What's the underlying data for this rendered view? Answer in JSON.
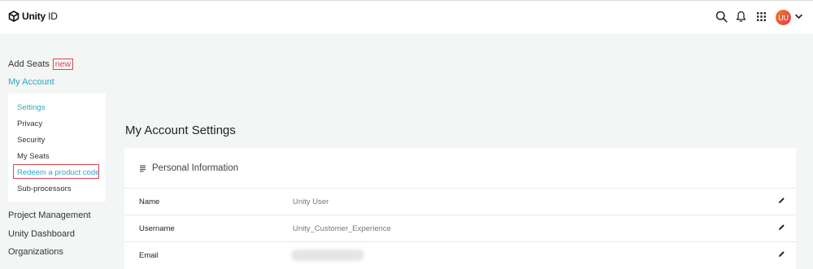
{
  "header": {
    "brand_bold": "Unity",
    "brand_light": " ID",
    "avatar_initials": "UU",
    "icons": [
      "search-icon",
      "bell-icon",
      "apps-grid-icon",
      "chevron-down-icon"
    ]
  },
  "sidebar": {
    "add_seats": "Add Seats",
    "new_badge": "new",
    "my_account": "My Account",
    "subitems": [
      {
        "label": "Settings"
      },
      {
        "label": "Privacy"
      },
      {
        "label": "Security"
      },
      {
        "label": "My Seats"
      },
      {
        "label": "Redeem a product code"
      },
      {
        "label": "Sub-processors"
      }
    ],
    "project_management": "Project Management",
    "unity_dashboard": "Unity Dashboard",
    "organizations": "Organizations"
  },
  "main": {
    "title": "My Account Settings",
    "section_title": "Personal Information",
    "rows": [
      {
        "label": "Name",
        "value": "Unity User"
      },
      {
        "label": "Username",
        "value": "Unity_Customer_Experience"
      },
      {
        "label": "Email",
        "value": ""
      }
    ]
  },
  "colors": {
    "accent": "#2aa7c7",
    "highlight": "#e0444f",
    "background": "#f4f6f6"
  }
}
